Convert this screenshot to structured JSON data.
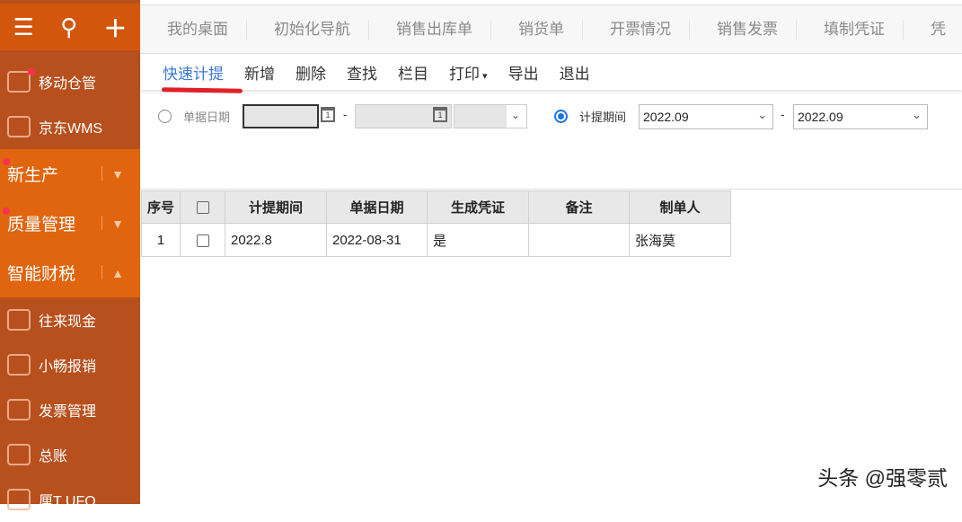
{
  "sidebar": {
    "top_icons": [
      "menu-icon",
      "search-icon",
      "plus-icon"
    ],
    "items_top": [
      {
        "label": "移动仓管",
        "dot": true
      },
      {
        "label": "京东WMS",
        "dot": false
      }
    ],
    "groups": [
      {
        "label": "新生产",
        "chevron": "⌄",
        "dot": true
      },
      {
        "label": "质量管理",
        "chevron": "⌄",
        "dot": true
      },
      {
        "label": "智能财税",
        "chevron": "⌃",
        "dot": false
      }
    ],
    "items_sub": [
      {
        "label": "往来现金"
      },
      {
        "label": "小畅报销"
      },
      {
        "label": "发票管理"
      },
      {
        "label": "总账"
      },
      {
        "label": "厘T UFO"
      }
    ]
  },
  "tabs": [
    "我的桌面",
    "初始化导航",
    "销售出库单",
    "销货单",
    "开票情况",
    "销售发票",
    "填制凭证",
    "凭"
  ],
  "toolbar": [
    "快速计提",
    "新增",
    "删除",
    "查找",
    "栏目",
    "打印",
    "导出",
    "退出"
  ],
  "filter": {
    "doc_date_label": "单据日期",
    "period_label": "计提期间",
    "period_from": "2022.09",
    "period_to": "2022.09",
    "dash": "-"
  },
  "table": {
    "headers": [
      "序号",
      "",
      "计提期间",
      "单据日期",
      "生成凭证",
      "备注",
      "制单人"
    ],
    "rows": [
      [
        "1",
        "",
        "2022.8",
        "2022-08-31",
        "是",
        "",
        "张海莫"
      ]
    ]
  },
  "watermark": "头条 @强零贰"
}
